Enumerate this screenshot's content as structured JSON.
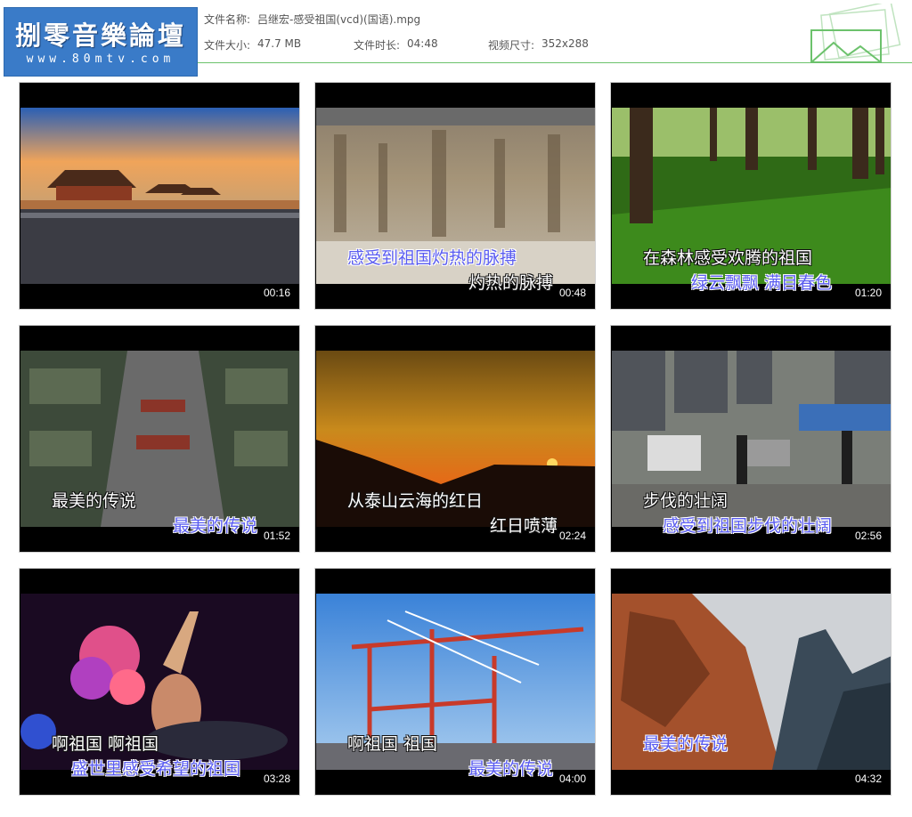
{
  "logo": {
    "title": "捌零音樂論壇",
    "url": "www.80mtv.com"
  },
  "file_info": {
    "name_label": "文件名称:",
    "name_value": "吕继宏-感受祖国(vcd)(国语).mpg",
    "size_label": "文件大小:",
    "size_value": "47.7 MB",
    "duration_label": "文件时长:",
    "duration_value": "04:48",
    "dimensions_label": "视频尺寸:",
    "dimensions_value": "352x288"
  },
  "thumbnails": [
    {
      "timestamp": "00:16",
      "subtitle_1": "",
      "subtitle_2": ""
    },
    {
      "timestamp": "00:48",
      "subtitle_1": "感受到祖国灼热的脉搏",
      "subtitle_2": "灼热的脉搏"
    },
    {
      "timestamp": "01:20",
      "subtitle_1": "在森林感受欢腾的祖国",
      "subtitle_2": "绿云飘飘  满目春色"
    },
    {
      "timestamp": "01:52",
      "subtitle_1": "最美的传说",
      "subtitle_2": "最美的传说"
    },
    {
      "timestamp": "02:24",
      "subtitle_1": "从泰山云海的红日",
      "subtitle_2": "红日喷薄"
    },
    {
      "timestamp": "02:56",
      "subtitle_1": "步伐的壮阔",
      "subtitle_2": "感受到祖国步伐的壮阔"
    },
    {
      "timestamp": "03:28",
      "subtitle_1": "啊祖国  啊祖国",
      "subtitle_2": "盛世里感受希望的祖国"
    },
    {
      "timestamp": "04:00",
      "subtitle_1": "啊祖国  祖国",
      "subtitle_2": "最美的传说"
    },
    {
      "timestamp": "04:32",
      "subtitle_1": "最美的传说",
      "subtitle_2": ""
    }
  ],
  "colors": {
    "accent_line": "#6cc26c",
    "logo_bg": "#3a7bc8",
    "subtitle_highlight": "#5a5cf0"
  }
}
